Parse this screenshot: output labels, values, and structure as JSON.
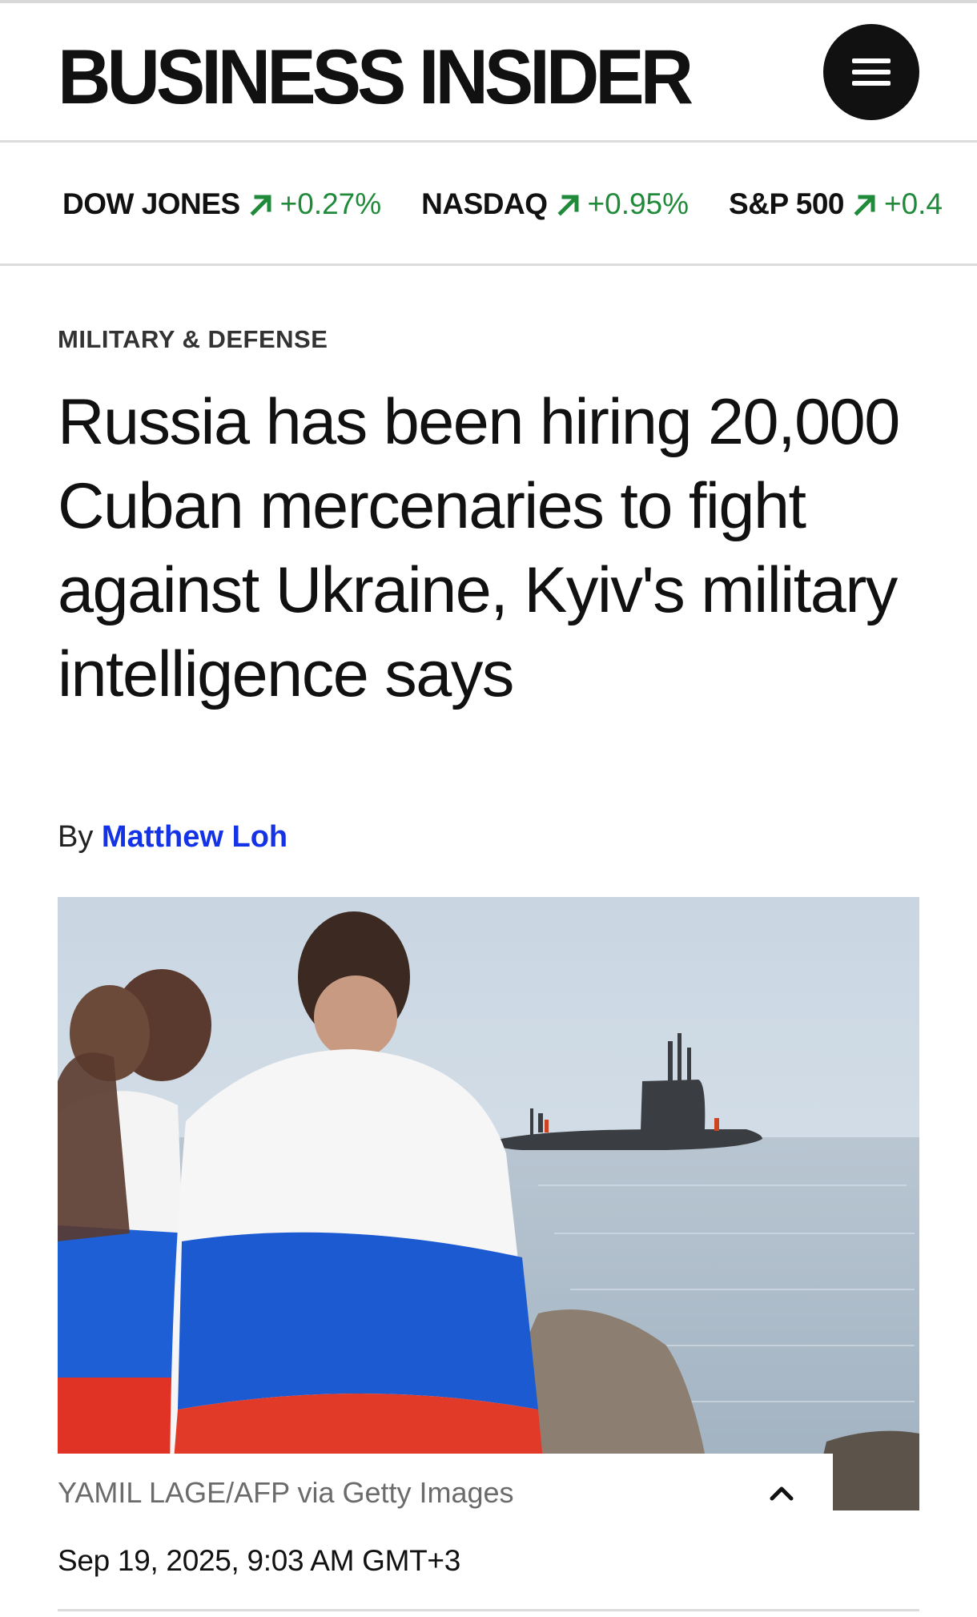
{
  "header": {
    "logo_text": "BUSINESS INSIDER",
    "menu_icon": "hamburger-menu-icon"
  },
  "ticker": {
    "items": [
      {
        "name": "DOW JONES",
        "change": "+0.27%",
        "direction": "up"
      },
      {
        "name": "NASDAQ",
        "change": "+0.95%",
        "direction": "up"
      },
      {
        "name": "S&P 500",
        "change": "+0.4",
        "direction": "up"
      }
    ],
    "up_color": "#1f8a3a"
  },
  "article": {
    "category": "MILITARY & DEFENSE",
    "headline": "Russia has been hiring 20,000 Cuban mercenaries to fight against Ukraine, Kyiv's military intelligence says",
    "byline_prefix": "By",
    "author": "Matthew Loh",
    "author_color": "#1433e6",
    "image_credit": "YAMIL LAGE/AFP via Getty Images",
    "caption_toggle_icon": "chevron-up-icon",
    "date": "Sep 19, 2025, 9:03 AM GMT+3"
  }
}
